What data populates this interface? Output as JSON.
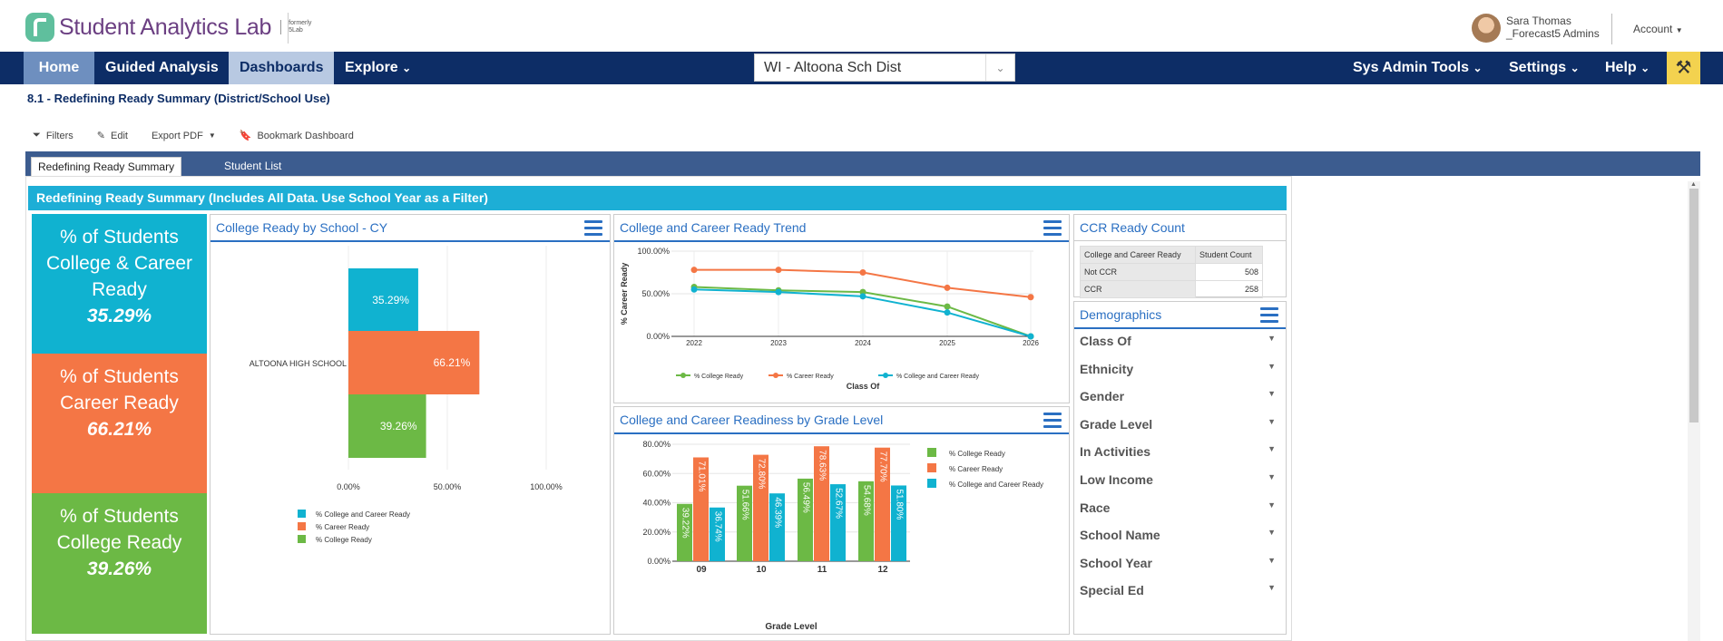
{
  "app": {
    "logo_text": "Student Analytics Lab",
    "logo_sub": "formerly 5Lab",
    "user_name": "Sara Thomas",
    "user_org": "_Forecast5 Admins",
    "account_label": "Account"
  },
  "nav": {
    "home": "Home",
    "guided": "Guided Analysis",
    "dashboards": "Dashboards",
    "explore": "Explore",
    "district": "WI - Altoona Sch Dist",
    "sys_admin": "Sys Admin Tools",
    "settings": "Settings",
    "help": "Help"
  },
  "page": {
    "title": "8.1 - Redefining Ready Summary (District/School Use)"
  },
  "toolbar": {
    "filters": "Filters",
    "edit": "Edit",
    "export": "Export PDF",
    "bookmark": "Bookmark Dashboard"
  },
  "tabs": [
    {
      "label": "Redefining Ready Summary"
    },
    {
      "label": "Student List"
    }
  ],
  "banner": "Redefining Ready Summary (Includes All Data. Use School Year as a Filter)",
  "kpis": [
    {
      "label": "% of Students College & Career Ready",
      "value": "35.29%",
      "color": "#10b2d0"
    },
    {
      "label": "% of Students Career Ready",
      "value": "66.21%",
      "color": "#f47645"
    },
    {
      "label": "% of Students College Ready",
      "value": "39.26%",
      "color": "#6cb945"
    }
  ],
  "panels": {
    "school": "College Ready by School - CY",
    "trend": "College and Career Ready Trend",
    "grade": "College and Career Readiness by Grade Level",
    "ccr_count": "CCR Ready Count",
    "demographics": "Demographics"
  },
  "ccr_table": {
    "headers": [
      "College and Career Ready",
      "Student Count"
    ],
    "rows": [
      {
        "label": "Not CCR",
        "count": "508"
      },
      {
        "label": "CCR",
        "count": "258"
      }
    ]
  },
  "demographics": [
    "Class Of",
    "Ethnicity",
    "Gender",
    "Grade Level",
    "In Activities",
    "Low Income",
    "Race",
    "School Name",
    "School Year",
    "Special Ed"
  ],
  "colors": {
    "ccr": "#10b2d0",
    "career": "#f47645",
    "college": "#6cb945",
    "navy": "#0d2d66",
    "link": "#2a6fc2"
  },
  "chart_data": [
    {
      "type": "bar",
      "orientation": "horizontal",
      "title": "College Ready by School - CY",
      "categories": [
        "ALTOONA HIGH SCHOOL"
      ],
      "series": [
        {
          "name": "% College and Career Ready",
          "values": [
            35.29
          ],
          "labels": [
            "35.29%"
          ]
        },
        {
          "name": "% Career Ready",
          "values": [
            66.21
          ],
          "labels": [
            "66.21%"
          ]
        },
        {
          "name": "% College Ready",
          "values": [
            39.26
          ],
          "labels": [
            "39.26%"
          ]
        }
      ],
      "xlim": [
        0,
        100
      ],
      "xticks": [
        "0.00%",
        "50.00%",
        "100.00%"
      ],
      "legend": "bottom"
    },
    {
      "type": "line",
      "title": "College and Career Ready Trend",
      "xlabel": "Class Of",
      "ylabel": "% Career Ready",
      "x": [
        "2022",
        "2023",
        "2024",
        "2025",
        "2026"
      ],
      "series": [
        {
          "name": "% College Ready",
          "values": [
            58,
            54,
            52,
            35,
            0
          ]
        },
        {
          "name": "% Career Ready",
          "values": [
            78,
            78,
            75,
            57,
            46
          ]
        },
        {
          "name": "% College and Career Ready",
          "values": [
            55,
            52,
            47,
            28,
            0
          ]
        }
      ],
      "ylim": [
        0,
        100
      ],
      "yticks": [
        "0.00%",
        "50.00%",
        "100.00%"
      ],
      "legend": "bottom"
    },
    {
      "type": "bar",
      "title": "College and Career Readiness by Grade Level",
      "xlabel": "Grade Level",
      "categories": [
        "09",
        "10",
        "11",
        "12"
      ],
      "series": [
        {
          "name": "% College Ready",
          "values": [
            39.22,
            51.66,
            56.49,
            54.68
          ],
          "labels": [
            "39.22%",
            "51.66%",
            "56.49%",
            "54.68%"
          ]
        },
        {
          "name": "% Career Ready",
          "values": [
            71.01,
            72.8,
            78.63,
            77.7
          ],
          "labels": [
            "71.01%",
            "72.80%",
            "78.63%",
            "77.70%"
          ]
        },
        {
          "name": "% College and Career Ready",
          "values": [
            36.74,
            46.39,
            52.67,
            51.8
          ],
          "labels": [
            "36.74%",
            "46.39%",
            "52.67%",
            "51.80%"
          ]
        }
      ],
      "ylim": [
        0,
        80
      ],
      "yticks": [
        "0.00%",
        "20.00%",
        "40.00%",
        "60.00%",
        "80.00%"
      ],
      "legend": "right"
    }
  ]
}
